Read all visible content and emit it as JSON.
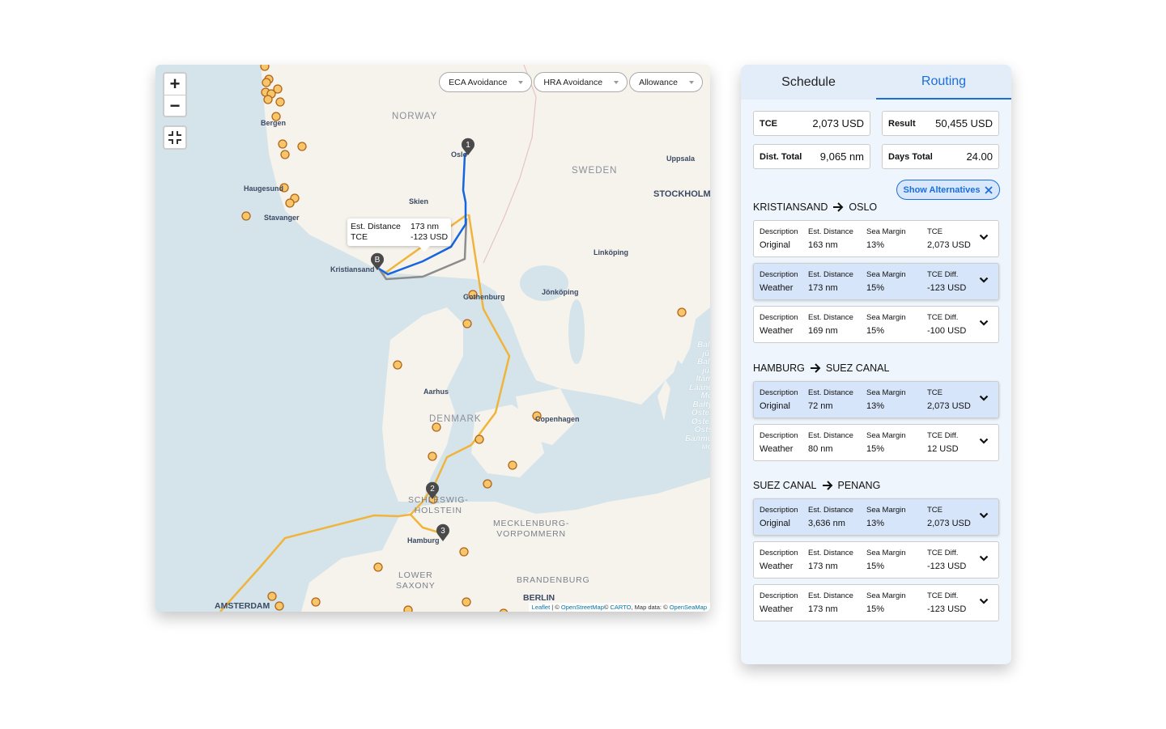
{
  "map": {
    "zoom_in": "+",
    "zoom_out": "−",
    "filters": [
      {
        "label": "ECA Avoidance"
      },
      {
        "label": "HRA Avoidance"
      },
      {
        "label": "Allowance"
      }
    ],
    "tooltip": {
      "est_distance_label": "Est. Distance",
      "est_distance_value": "173  nm",
      "tce_label": "TCE",
      "tce_value": "-123 USD"
    },
    "markers": {
      "start": "B",
      "p1": "1",
      "p2": "2",
      "p3": "3"
    },
    "labels": {
      "norway": "NORWAY",
      "sweden": "SWEDEN",
      "denmark": "DENMARK",
      "bergen": "Bergen",
      "haugesund": "Haugesund",
      "stavanger": "Stavanger",
      "kristiansand": "Kristiansand",
      "skien": "Skien",
      "oslo": "Oslo",
      "uppsala": "Uppsala",
      "stockholm": "STOCKHOLM",
      "linkoping": "Linköping",
      "jonkoping": "Jönköping",
      "gothenburg": "Gothenburg",
      "aarhus": "Aarhus",
      "copenhagen": "Copenhagen",
      "schleswig1": "SCHLESWIG-",
      "schleswig2": "HOLSTEIN",
      "hamburg": "Hamburg",
      "mecklenburg1": "MECKLENBURG-",
      "mecklenburg2": "VORPOMMERN",
      "lower1": "LOWER",
      "lower2": "SAXONY",
      "brandenburg": "BRANDENBURG",
      "berlin": "BERLIN",
      "amsterdam": "AMSTERDAM",
      "baltic_sea": [
        "Balt",
        "jūr",
        "Balt",
        "jūr",
        "Itām",
        "Lääne",
        "Mo",
        "Bałty",
        "Öster",
        "Øster",
        "Osts",
        "Балти",
        "мо"
      ]
    },
    "attribution": {
      "leaflet": "Leaflet",
      "sep": " | © ",
      "osm": "OpenStreetMap",
      "carto_pre": "© ",
      "carto": "CARTO",
      "mapdata": ", Map data: © ",
      "openseamap": "OpenSeaMap"
    },
    "colors": {
      "water": "#d4e4ea",
      "land": "#f6f3ec",
      "route_main": "#f0b43c",
      "route_weather": "#1565e0",
      "route_alt": "#8c8c8c",
      "port": "#f7c56a",
      "port_border": "#b0651a"
    }
  },
  "panel": {
    "tabs": [
      {
        "label": "Schedule",
        "active": false
      },
      {
        "label": "Routing",
        "active": true
      }
    ],
    "kpis": [
      {
        "label": "TCE",
        "value": "2,073 USD"
      },
      {
        "label": "Result",
        "value": "50,455 USD"
      },
      {
        "label": "Dist. Total",
        "value": "9,065 nm"
      },
      {
        "label": "Days Total",
        "value": "24.00"
      }
    ],
    "show_alternatives": "Show Alternatives",
    "legs": [
      {
        "from": "KRISTIANSAND",
        "to": "OSLO",
        "options": [
          {
            "desc": "Original",
            "dist": "163 nm",
            "margin": "13%",
            "tce_label": "TCE",
            "tce": "2,073 USD",
            "highlighted": false
          },
          {
            "desc": "Weather",
            "dist": "173 nm",
            "margin": "15%",
            "tce_label": "TCE Diff.",
            "tce": "-123 USD",
            "highlighted": true
          },
          {
            "desc": "Weather",
            "dist": "169 nm",
            "margin": "15%",
            "tce_label": "TCE Diff.",
            "tce": "-100 USD",
            "highlighted": false
          }
        ]
      },
      {
        "from": "HAMBURG",
        "to": "SUEZ CANAL",
        "options": [
          {
            "desc": "Original",
            "dist": "72 nm",
            "margin": "13%",
            "tce_label": "TCE",
            "tce": "2,073 USD",
            "highlighted": true
          },
          {
            "desc": "Weather",
            "dist": "80 nm",
            "margin": "15%",
            "tce_label": "TCE Diff.",
            "tce": "12 USD",
            "highlighted": false
          }
        ]
      },
      {
        "from": "SUEZ CANAL",
        "to": "PENANG",
        "options": [
          {
            "desc": "Original",
            "dist": "3,636 nm",
            "margin": "13%",
            "tce_label": "TCE",
            "tce": "2,073 USD",
            "highlighted": true
          },
          {
            "desc": "Weather",
            "dist": "173 nm",
            "margin": "15%",
            "tce_label": "TCE Diff.",
            "tce": "-123 USD",
            "highlighted": false
          },
          {
            "desc": "Weather",
            "dist": "173 nm",
            "margin": "15%",
            "tce_label": "TCE Diff.",
            "tce": "-123 USD",
            "highlighted": false
          }
        ]
      }
    ],
    "col_headers": {
      "desc": "Description",
      "dist": "Est. Distance",
      "margin": "Sea Margin"
    },
    "accent": "#1a6fd8"
  }
}
